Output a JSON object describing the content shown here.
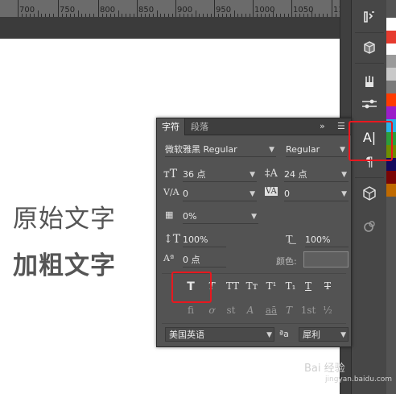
{
  "ruler": {
    "labels": [
      "700",
      "750",
      "800",
      "850",
      "900",
      "950",
      "1000",
      "1050",
      "11"
    ]
  },
  "canvas": {
    "text_regular": "原始文字",
    "text_bold": "加粗文字"
  },
  "panel": {
    "tabs": [
      {
        "label": "字符",
        "active": true
      },
      {
        "label": "段落",
        "active": false
      }
    ],
    "collapse_glyph": "»",
    "font_family": "微软雅黑 Regular",
    "font_style": "Regular",
    "font_size": "36 点",
    "leading": "24 点",
    "kerning": "0",
    "tracking": "0",
    "tsume": "0%",
    "vertical_scale": "100%",
    "horizontal_scale": "100%",
    "baseline_shift": "0 点",
    "color_label": "颜色:",
    "language": "美国英语",
    "antialias_label": "ªa",
    "antialias": "犀利",
    "style_buttons": [
      {
        "name": "faux-bold",
        "glyph": "T",
        "active": true
      },
      {
        "name": "faux-italic",
        "glyph": "T"
      },
      {
        "name": "all-caps",
        "glyph": "TT"
      },
      {
        "name": "small-caps",
        "glyph": "Tт"
      },
      {
        "name": "superscript",
        "glyph": "T¹"
      },
      {
        "name": "subscript",
        "glyph": "T₁"
      },
      {
        "name": "underline",
        "glyph": "T"
      },
      {
        "name": "strikethrough",
        "glyph": "T"
      }
    ],
    "opentype_buttons": [
      "fi",
      "ơ",
      "st",
      "A",
      "aā",
      "T",
      "1st",
      "½"
    ]
  },
  "tools": {
    "icons": [
      "history-icon",
      "3d-object-icon",
      "brushes-icon",
      "adjustments-icon",
      "character-panel-icon",
      "paragraph-icon",
      "3d-cube-icon",
      "paths-icon"
    ],
    "character_glyph": "A|"
  },
  "colors": {
    "accent_highlight": "#e8181f",
    "swatches": [
      "#ffffff",
      "#e63b2e",
      "#ffffff",
      "#9a9a9a",
      "#c9c9c9",
      "#7a7a7a",
      "#ff3b00",
      "#9b1dc9",
      "#2bb3e8",
      "#2c9e3a",
      "#6e8d00",
      "#140a5c",
      "#7a0505",
      "#c06a00"
    ]
  },
  "watermark": {
    "text": "Bai 经验",
    "sub": "jingyan.baidu.com"
  }
}
